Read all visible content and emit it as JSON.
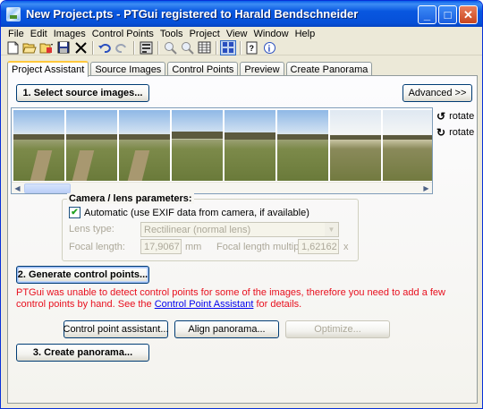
{
  "window": {
    "title": "New Project.pts - PTGui registered to Harald Bendschneider",
    "minimize": "_",
    "maximize": "□",
    "close": "✕"
  },
  "menu": [
    "File",
    "Edit",
    "Images",
    "Control Points",
    "Tools",
    "Project",
    "View",
    "Window",
    "Help"
  ],
  "toolbar": {
    "icons": [
      "new-icon",
      "open-icon",
      "open-dropdown-icon",
      "save-icon",
      "delete-icon",
      "undo-icon",
      "redo-icon",
      "settings-icon",
      "zoom-in-icon",
      "zoom-out-icon",
      "table-icon",
      "panorama-editor-icon",
      "help-icon",
      "info-icon"
    ]
  },
  "tabs": [
    "Project Assistant",
    "Source Images",
    "Control Points",
    "Preview",
    "Create Panorama"
  ],
  "assistant": {
    "select_images": "1. Select source images...",
    "advanced": "Advanced >>",
    "rotate1": "rotate",
    "rotate2": "rotate",
    "lens_group_title": "Camera / lens parameters:",
    "automatic_label": "Automatic (use EXIF data from camera, if available)",
    "automatic_checked": true,
    "lens_type_label": "Lens type:",
    "lens_type_value": "Rectilinear (normal lens)",
    "focal_length_label": "Focal length:",
    "focal_length_value": "17,9067",
    "focal_length_unit": "mm",
    "multiplier_label": "Focal length multiplier:",
    "multiplier_value": "1,62162",
    "multiplier_unit": "x",
    "generate_cp": "2. Generate control points...",
    "warning_text": "PTGui was unable to detect control points for some of the images, therefore you need to add a few control points by hand. See the",
    "warning_link": "Control Point Assistant",
    "warning_tail": "for details.",
    "cp_assistant": "Control point assistant...",
    "align": "Align panorama...",
    "optimize": "Optimize...",
    "create": "3. Create panorama..."
  },
  "colors": {
    "titlebar": "#0a5ee8",
    "window_face": "#ece9d8",
    "warning": "#e8101e",
    "link": "#0000ee"
  }
}
